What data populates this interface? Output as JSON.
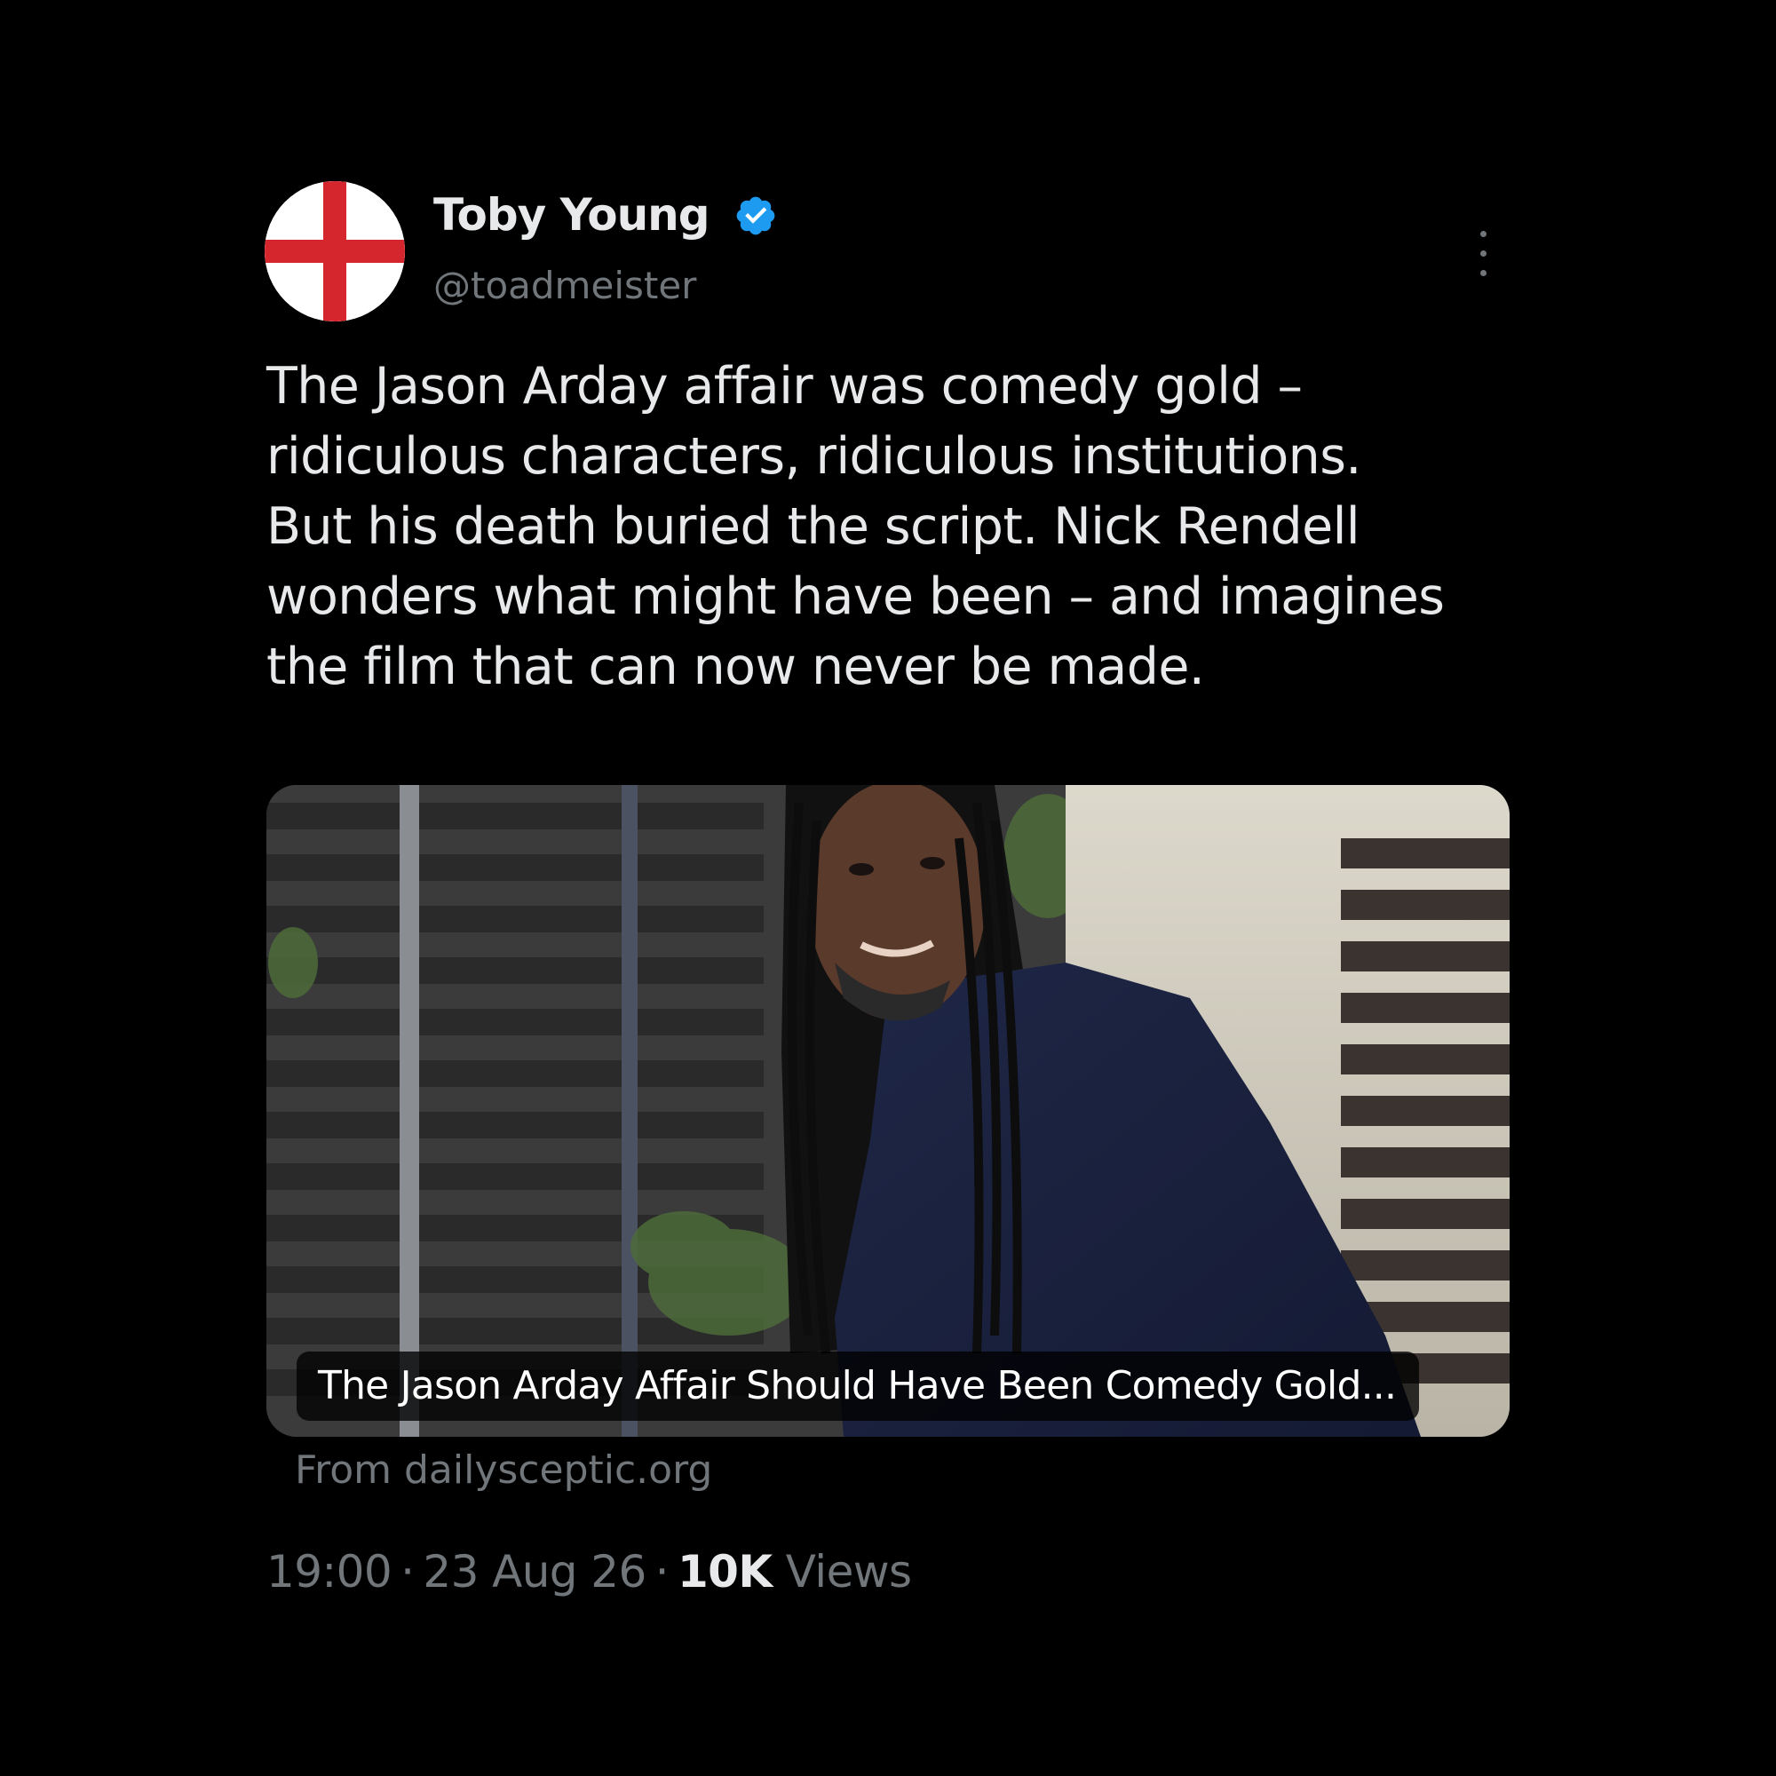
{
  "tweet": {
    "author": {
      "display_name": "Toby Young",
      "handle": "@toadmeister",
      "verified_icon": "verified-badge-icon",
      "verified_color": "#1d9bf0",
      "avatar": "st-george-cross-flag"
    },
    "text_lines": [
      "The Jason Arday affair was comedy gold –",
      "ridiculous characters, ridiculous institutions.",
      "But his death buried the script. Nick Rendell",
      "wonders what might have been – and imagines",
      "the film that can now never be made."
    ],
    "card": {
      "title": "The Jason Arday Affair Should Have Been Comedy Gold...",
      "source": "From dailysceptic.org"
    },
    "meta": {
      "time": "19:00",
      "separator": "·",
      "date": "23 Aug 26",
      "views_count": "10K",
      "views_label": "Views"
    }
  },
  "colors": {
    "background": "#000000",
    "text_primary": "#e7e9ea",
    "text_secondary": "#71767b",
    "accent": "#1d9bf0",
    "flag_red": "#d6262d"
  }
}
